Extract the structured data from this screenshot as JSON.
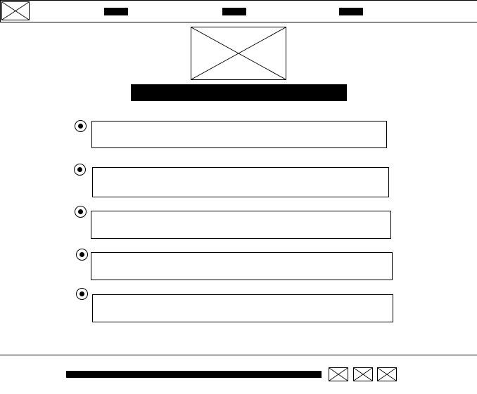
{
  "header": {
    "logo_icon": "image-placeholder-icon",
    "nav": [
      {
        "label": ""
      },
      {
        "label": ""
      },
      {
        "label": ""
      }
    ]
  },
  "hero": {
    "image_icon": "image-placeholder-icon",
    "title": ""
  },
  "options": [
    {
      "value": "",
      "selected": true
    },
    {
      "value": "",
      "selected": true
    },
    {
      "value": "",
      "selected": true
    },
    {
      "value": "",
      "selected": true
    },
    {
      "value": "",
      "selected": true
    }
  ],
  "footer": {
    "text": "",
    "icons": [
      "image-placeholder-icon",
      "image-placeholder-icon",
      "image-placeholder-icon"
    ]
  },
  "colors": {
    "ink": "#000000",
    "background": "#ffffff"
  }
}
